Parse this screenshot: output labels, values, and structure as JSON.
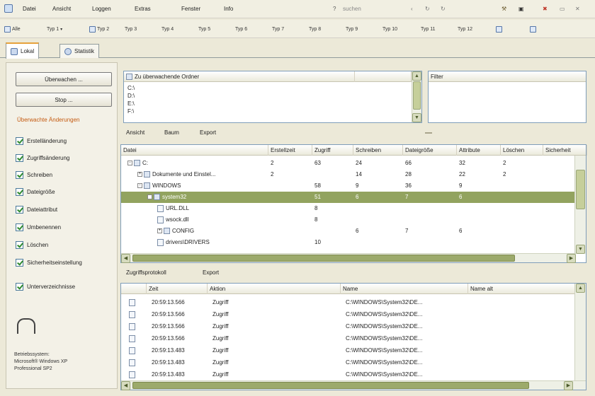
{
  "menu": [
    "Datei",
    "Ansicht",
    "Loggen",
    "Extras",
    "Fenster",
    "Info"
  ],
  "search": {
    "label": "suchen"
  },
  "toolbar": [
    "Alle",
    "Typ 1",
    "Typ 2",
    "Typ 3",
    "Typ 4",
    "Typ 5",
    "Typ 6",
    "Typ 7",
    "Typ 8",
    "Typ 9",
    "Typ 10",
    "Typ 11",
    "Typ 12"
  ],
  "tabs": [
    {
      "label": "Lokal"
    },
    {
      "label": "Statistik"
    }
  ],
  "left": {
    "scan_button": "Überwachen ...",
    "stop_button": "Stop ...",
    "section_title": "Überwachte Änderungen",
    "checkboxes": [
      "Erstelländerung",
      "Zugriffsänderung",
      "Schreiben",
      "Dateigröße",
      "Dateiattribut",
      "Umbenennen",
      "Löschen",
      "Sicherheitseinstellung",
      "Unterverzeichnisse"
    ],
    "info_lines": [
      "Betriebssystem:",
      "Microsoft® Windows XP",
      "Professional SP2"
    ]
  },
  "drives": {
    "header": "Zu überwachende Ordner",
    "items": [
      "C:\\",
      "D:\\",
      "E:\\",
      "F:\\"
    ]
  },
  "filter": {
    "header": "Filter"
  },
  "tree_links": [
    "Ansicht",
    "Baum",
    "Export"
  ],
  "tree_columns": [
    "Datei",
    "Erstellzeit",
    "Zugriff",
    "Schreiben",
    "Dateigröße",
    "Attribute",
    "Löschen",
    "Sicherheit"
  ],
  "tree_rows": [
    {
      "name": "C:",
      "indent": 0,
      "toggle": "-",
      "icon": "folder-icon",
      "cols": [
        "2",
        "63",
        "24",
        "66",
        "32",
        "2",
        ""
      ]
    },
    {
      "name": "Dokumente und Einstel...",
      "indent": 1,
      "toggle": "+",
      "icon": "folder-icon",
      "cols": [
        "2",
        "",
        "14",
        "28",
        "22",
        "2",
        ""
      ]
    },
    {
      "name": "WINDOWS",
      "indent": 1,
      "toggle": "-",
      "icon": "folder-icon",
      "cols": [
        "",
        "58",
        "9",
        "36",
        "9",
        "",
        ""
      ]
    },
    {
      "name": "system32",
      "indent": 2,
      "toggle": "-",
      "icon": "folder-icon",
      "cols": [
        "",
        "51",
        "6",
        "7",
        "6",
        "",
        ""
      ],
      "selected": true
    },
    {
      "name": "URL.DLL",
      "indent": 3,
      "toggle": "",
      "icon": "file-icon",
      "cols": [
        "",
        "8",
        "",
        "",
        "",
        "",
        ""
      ]
    },
    {
      "name": "wsock.dll",
      "indent": 3,
      "toggle": "",
      "icon": "file-icon",
      "cols": [
        "",
        "8",
        "",
        "",
        "",
        "",
        ""
      ]
    },
    {
      "name": "CONFIG",
      "indent": 3,
      "toggle": "+",
      "icon": "folder-icon",
      "cols": [
        "",
        "",
        "6",
        "7",
        "6",
        "",
        ""
      ]
    },
    {
      "name": "drivers\\DRIVERS",
      "indent": 3,
      "toggle": "",
      "icon": "file-icon",
      "cols": [
        "",
        "10",
        "",
        "",
        "",
        "",
        ""
      ]
    }
  ],
  "log_links": [
    "Zugriffsprotokoll",
    "Export"
  ],
  "log_columns": [
    "",
    "Zeit",
    "Aktion",
    "Name",
    "Name alt"
  ],
  "log_rows": [
    {
      "time": "20:59:13.566",
      "action": "Zugriff",
      "name": "C:\\WINDOWS\\System32\\DE..."
    },
    {
      "time": "20:59:13.566",
      "action": "Zugriff",
      "name": "C:\\WINDOWS\\System32\\DE..."
    },
    {
      "time": "20:59:13.566",
      "action": "Zugriff",
      "name": "C:\\WINDOWS\\System32\\DE..."
    },
    {
      "time": "20:59:13.566",
      "action": "Zugriff",
      "name": "C:\\WINDOWS\\System32\\DE..."
    },
    {
      "time": "20:59:13.483",
      "action": "Zugriff",
      "name": "C:\\WINDOWS\\System32\\DE..."
    },
    {
      "time": "20:59:13.483",
      "action": "Zugriff",
      "name": "C:\\WINDOWS\\System32\\DE..."
    },
    {
      "time": "20:59:13.483",
      "action": "Zugriff",
      "name": "C:\\WINDOWS\\System32\\DE..."
    }
  ],
  "colors": {
    "accent": "#e6a23c",
    "selection": "#92a35f",
    "scroll": "#9caa6b"
  }
}
